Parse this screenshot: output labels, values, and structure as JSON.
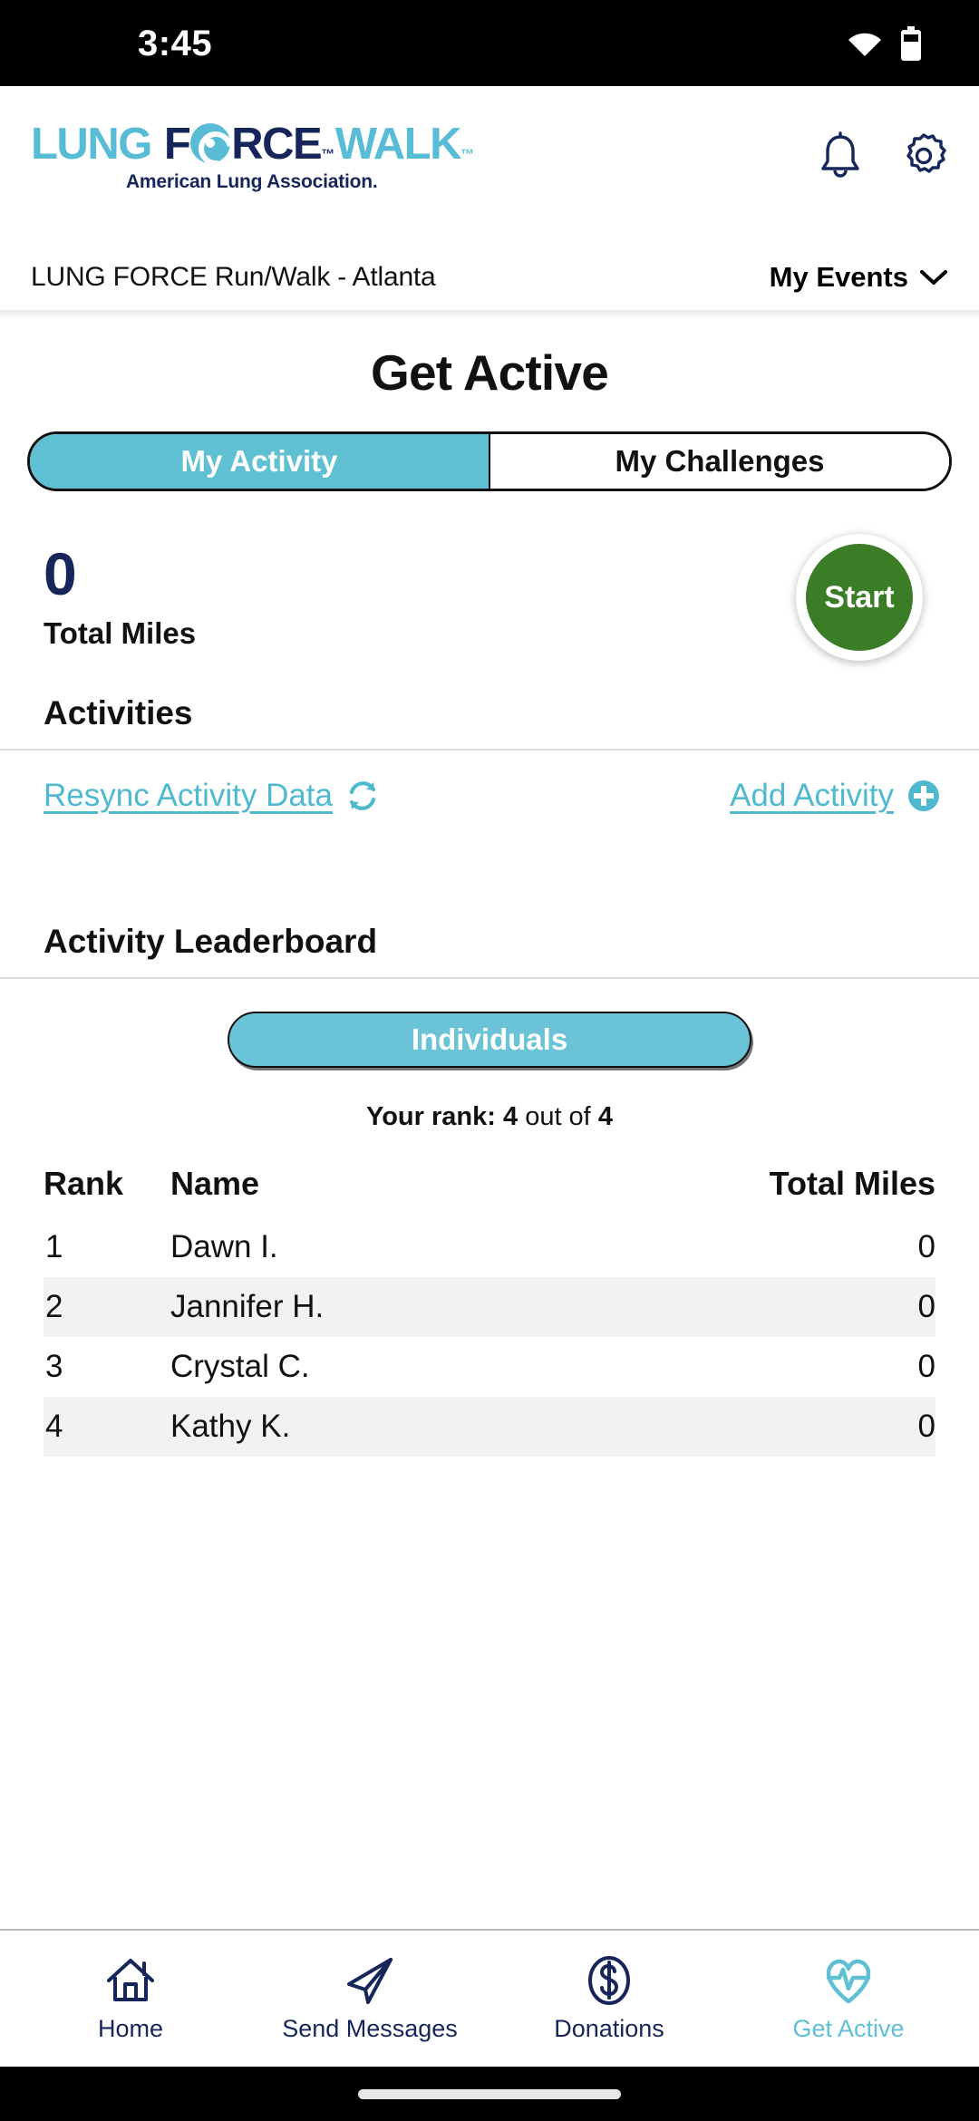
{
  "status_bar": {
    "time": "3:45",
    "wifi_icon": "wifi-icon",
    "battery_icon": "battery-icon"
  },
  "header": {
    "logo": {
      "word1": "LUNG",
      "word2_pre": "F",
      "word2_post": "RCE",
      "word2_tm": "™",
      "word3": "WALK",
      "word3_tm": "™",
      "tagline": "American Lung Association.",
      "color_blue": "#58BCD6",
      "color_navy": "#16265A"
    },
    "notifications_icon": "bell-icon",
    "settings_icon": "gear-icon"
  },
  "event_bar": {
    "event_name": "LUNG FORCE Run/Walk - Atlanta",
    "my_events_label": "My Events",
    "chevron_icon": "chevron-down-icon"
  },
  "page": {
    "title": "Get Active",
    "tabs": [
      {
        "label": "My Activity",
        "active": true
      },
      {
        "label": "My Challenges",
        "active": false
      }
    ],
    "stats": {
      "total_miles_value": "0",
      "total_miles_label": "Total Miles",
      "start_button_label": "Start",
      "start_button_color": "#3B7D27"
    },
    "activities": {
      "heading": "Activities",
      "resync_label": "Resync Activity Data",
      "resync_icon": "refresh-icon",
      "add_label": "Add Activity",
      "add_icon": "plus-circle-icon",
      "link_color": "#4FB9CF"
    },
    "leaderboard": {
      "heading": "Activity Leaderboard",
      "filter_label": "Individuals",
      "filter_color": "#6AC3D6",
      "rank_prefix": "Your rank:",
      "rank_value": "4",
      "rank_middle": "out of",
      "rank_total": "4",
      "columns": [
        "Rank",
        "Name",
        "Total Miles"
      ],
      "rows": [
        {
          "rank": "1",
          "name": "Dawn I.",
          "miles": "0"
        },
        {
          "rank": "2",
          "name": "Jannifer H.",
          "miles": "0"
        },
        {
          "rank": "3",
          "name": "Crystal C.",
          "miles": "0"
        },
        {
          "rank": "4",
          "name": "Kathy K.",
          "miles": "0"
        }
      ]
    }
  },
  "bottom_nav": {
    "active_color": "#5FC0D4",
    "inactive_color": "#16265A",
    "items": [
      {
        "label": "Home",
        "icon": "home-icon",
        "active": false
      },
      {
        "label": "Send Messages",
        "icon": "paper-plane-icon",
        "active": false
      },
      {
        "label": "Donations",
        "icon": "dollar-circle-icon",
        "active": false
      },
      {
        "label": "Get Active",
        "icon": "heart-pulse-icon",
        "active": true
      }
    ]
  }
}
